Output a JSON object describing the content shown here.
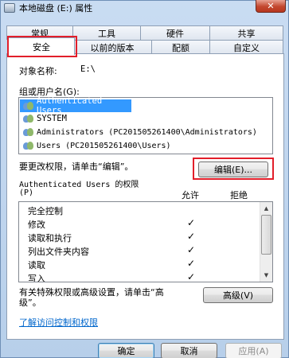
{
  "window": {
    "title": "本地磁盘 (E:) 属性",
    "close_label": "✕"
  },
  "tabs_row1": [
    "常规",
    "工具",
    "硬件",
    "共享"
  ],
  "tabs_row2": [
    "安全",
    "以前的版本",
    "配额",
    "自定义"
  ],
  "object": {
    "label": "对象名称:",
    "value": "E:\\"
  },
  "group_label": "组或用户名(G):",
  "users": [
    "Authenticated Users",
    "SYSTEM",
    "Administrators (PC201505261400\\Administrators)",
    "Users (PC201505261400\\Users)"
  ],
  "change_hint": "要更改权限，请单击“编辑”。",
  "edit_button": "编辑(E)...",
  "perm_header": {
    "title_line1": "Authenticated Users 的权限",
    "title_line2": "(P)",
    "allow": "允许",
    "deny": "拒绝"
  },
  "permissions": [
    {
      "name": "完全控制",
      "allow": ""
    },
    {
      "name": "修改",
      "allow": "✓"
    },
    {
      "name": "读取和执行",
      "allow": "✓"
    },
    {
      "name": "列出文件夹内容",
      "allow": "✓"
    },
    {
      "name": "读取",
      "allow": "✓"
    },
    {
      "name": "写入",
      "allow": "✓"
    }
  ],
  "special_hint_line1": "有关特殊权限或高级设置，请单击“高",
  "special_hint_line2": "级”。",
  "advanced_button": "高级(V)",
  "learn_link": "了解访问控制和权限",
  "footer": {
    "ok": "确定",
    "cancel": "取消",
    "apply": "应用(A)"
  },
  "scrollbar": {
    "up": "▲",
    "down": "▼"
  }
}
